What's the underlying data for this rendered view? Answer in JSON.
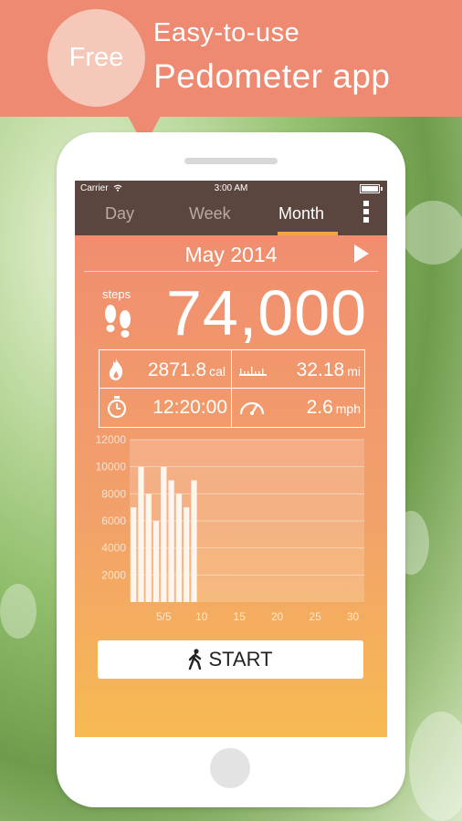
{
  "banner": {
    "badge": "Free",
    "line1": "Easy-to-use",
    "line2": "Pedometer app"
  },
  "status_bar": {
    "carrier": "Carrier",
    "time": "3:00 AM"
  },
  "tabs": [
    {
      "label": "Day",
      "active": false
    },
    {
      "label": "Week",
      "active": false
    },
    {
      "label": "Month",
      "active": true
    }
  ],
  "period": {
    "title": "May 2014"
  },
  "steps": {
    "label": "steps",
    "value": "74,000"
  },
  "stats": {
    "calories": {
      "value": "2871.8",
      "unit": "cal"
    },
    "distance": {
      "value": "32.18",
      "unit": "mi"
    },
    "duration": {
      "value": "12:20:00"
    },
    "speed": {
      "value": "2.6",
      "unit": "mph"
    }
  },
  "chart_data": {
    "type": "bar",
    "y_ticks": [
      "12000",
      "10000",
      "8000",
      "6000",
      "4000",
      "2000"
    ],
    "x_tick_labels": [
      "5/5",
      "10",
      "15",
      "20",
      "25",
      "30"
    ],
    "ylim": [
      0,
      12000
    ],
    "x": [
      1,
      2,
      3,
      4,
      5,
      6,
      7,
      8,
      9
    ],
    "values": [
      7000,
      10000,
      8000,
      6000,
      10000,
      9000,
      8000,
      7000,
      9000
    ],
    "grid": true
  },
  "start_button": {
    "label": "START"
  },
  "colors": {
    "banner": "#ef8a72",
    "screen_top": "#f08a70",
    "screen_bottom": "#f7ba52",
    "tab_bar": "#5a463f",
    "tab_active_underline": "#f6a43f"
  }
}
